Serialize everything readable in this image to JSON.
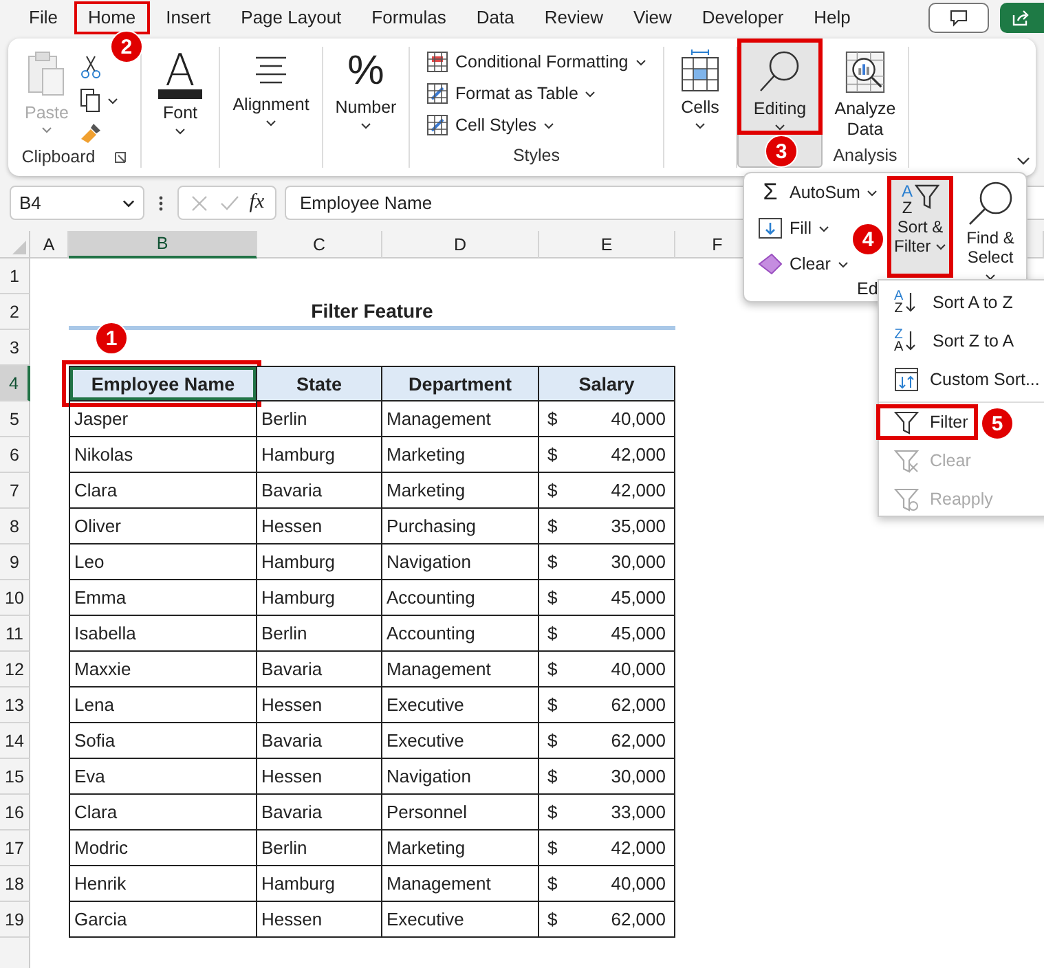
{
  "menu_tabs": [
    {
      "label": "File",
      "highlighted": false
    },
    {
      "label": "Home",
      "highlighted": true,
      "badge": "2"
    },
    {
      "label": "Insert",
      "highlighted": false
    },
    {
      "label": "Page Layout",
      "highlighted": false
    },
    {
      "label": "Formulas",
      "highlighted": false
    },
    {
      "label": "Data",
      "highlighted": false
    },
    {
      "label": "Review",
      "highlighted": false
    },
    {
      "label": "View",
      "highlighted": false
    },
    {
      "label": "Developer",
      "highlighted": false
    },
    {
      "label": "Help",
      "highlighted": false
    }
  ],
  "ribbon_groups": [
    {
      "kind": "clipboard",
      "paste": "Paste",
      "paste_disabled": true,
      "label": "Clipboard"
    },
    {
      "kind": "font",
      "button": "Font",
      "icon_text": "A"
    },
    {
      "kind": "alignment",
      "button": "Alignment"
    },
    {
      "kind": "number",
      "button": "Number",
      "icon_text": "%"
    },
    {
      "kind": "styles",
      "items": [
        "Conditional Formatting",
        "Format as Table",
        "Cell Styles"
      ],
      "label": "Styles"
    },
    {
      "kind": "cells",
      "button": "Cells"
    },
    {
      "kind": "editing",
      "button": "Editing",
      "selected": true,
      "highlighted": true,
      "badge": "3"
    },
    {
      "kind": "analysis",
      "button": "Analyze Data",
      "label": "Analysis"
    }
  ],
  "formula_bar": {
    "name_box": "B4",
    "fx": "fx",
    "formula": "Employee Name"
  },
  "column_headers": [
    {
      "label": "A",
      "selected": false
    },
    {
      "label": "B",
      "selected": true
    },
    {
      "label": "C",
      "selected": false
    },
    {
      "label": "D",
      "selected": false
    },
    {
      "label": "E",
      "selected": false
    },
    {
      "label": "F",
      "selected": false
    }
  ],
  "row_headers": [
    {
      "label": "1",
      "selected": false
    },
    {
      "label": "2",
      "selected": false
    },
    {
      "label": "3",
      "selected": false
    },
    {
      "label": "4",
      "selected": true
    },
    {
      "label": "5",
      "selected": false
    },
    {
      "label": "6",
      "selected": false
    },
    {
      "label": "7",
      "selected": false
    },
    {
      "label": "8",
      "selected": false
    },
    {
      "label": "9",
      "selected": false
    },
    {
      "label": "10",
      "selected": false
    },
    {
      "label": "11",
      "selected": false
    },
    {
      "label": "12",
      "selected": false
    },
    {
      "label": "13",
      "selected": false
    },
    {
      "label": "14",
      "selected": false
    },
    {
      "label": "15",
      "selected": false
    },
    {
      "label": "16",
      "selected": false
    },
    {
      "label": "17",
      "selected": false
    },
    {
      "label": "18",
      "selected": false
    },
    {
      "label": "19",
      "selected": false
    }
  ],
  "sheet": {
    "title": "Filter Feature",
    "columns": [
      {
        "label": "Employee Name",
        "selected": true,
        "highlighted": true,
        "badge": "1"
      },
      {
        "label": "State",
        "selected": false,
        "highlighted": false
      },
      {
        "label": "Department",
        "selected": false,
        "highlighted": false
      },
      {
        "label": "Salary",
        "selected": false,
        "highlighted": false
      }
    ],
    "rows": [
      {
        "name": "Jasper",
        "state": "Berlin",
        "department": "Management",
        "currency": "$",
        "salary": "40,000"
      },
      {
        "name": "Nikolas",
        "state": "Hamburg",
        "department": "Marketing",
        "currency": "$",
        "salary": "42,000"
      },
      {
        "name": "Clara",
        "state": "Bavaria",
        "department": "Marketing",
        "currency": "$",
        "salary": "42,000"
      },
      {
        "name": "Oliver",
        "state": "Hessen",
        "department": "Purchasing",
        "currency": "$",
        "salary": "35,000"
      },
      {
        "name": "Leo",
        "state": "Hamburg",
        "department": "Navigation",
        "currency": "$",
        "salary": "30,000"
      },
      {
        "name": "Emma",
        "state": "Hamburg",
        "department": "Accounting",
        "currency": "$",
        "salary": "45,000"
      },
      {
        "name": "Isabella",
        "state": "Berlin",
        "department": "Accounting",
        "currency": "$",
        "salary": "45,000"
      },
      {
        "name": "Maxxie",
        "state": "Bavaria",
        "department": "Management",
        "currency": "$",
        "salary": "40,000"
      },
      {
        "name": "Lena",
        "state": "Hessen",
        "department": "Executive",
        "currency": "$",
        "salary": "62,000"
      },
      {
        "name": "Sofia",
        "state": "Bavaria",
        "department": "Executive",
        "currency": "$",
        "salary": "62,000"
      },
      {
        "name": "Eva",
        "state": "Hessen",
        "department": "Navigation",
        "currency": "$",
        "salary": "30,000"
      },
      {
        "name": "Clara",
        "state": "Bavaria",
        "department": "Personnel",
        "currency": "$",
        "salary": "33,000"
      },
      {
        "name": "Modric",
        "state": "Berlin",
        "department": "Marketing",
        "currency": "$",
        "salary": "42,000"
      },
      {
        "name": "Henrik",
        "state": "Hamburg",
        "department": "Management",
        "currency": "$",
        "salary": "40,000"
      },
      {
        "name": "Garcia",
        "state": "Hessen",
        "department": "Executive",
        "currency": "$",
        "salary": "62,000"
      }
    ]
  },
  "editing_menu": {
    "items": [
      {
        "kind": "autosum",
        "label": "AutoSum",
        "icon_text": "Σ"
      },
      {
        "kind": "fill",
        "label": "Fill"
      },
      {
        "kind": "clear",
        "label": "Clear"
      }
    ],
    "big": [
      {
        "kind": "sort",
        "label": "Sort & Filter",
        "icon_top": "A",
        "icon_bottom": "Z",
        "highlighted": true,
        "badge": "4"
      },
      {
        "kind": "find",
        "label": "Find & Select",
        "highlighted": false
      }
    ],
    "group_label": "Ed"
  },
  "sort_menu": [
    {
      "kind": "sort",
      "label": "Sort A to Z",
      "icon_top": "A",
      "icon_bottom": "Z",
      "disabled": false,
      "highlighted": false
    },
    {
      "kind": "sort",
      "label": "Sort Z to A",
      "icon_top": "Z",
      "icon_bottom": "A",
      "disabled": false,
      "highlighted": false
    },
    {
      "kind": "custom",
      "label": "Custom Sort...",
      "disabled": false,
      "highlighted": false
    },
    {
      "kind": "filter",
      "label": "Filter",
      "disabled": false,
      "highlighted": true,
      "badge": "5"
    },
    {
      "kind": "clear",
      "label": "Clear",
      "disabled": true,
      "highlighted": false
    },
    {
      "kind": "reapply",
      "label": "Reapply",
      "disabled": true,
      "highlighted": false
    }
  ]
}
